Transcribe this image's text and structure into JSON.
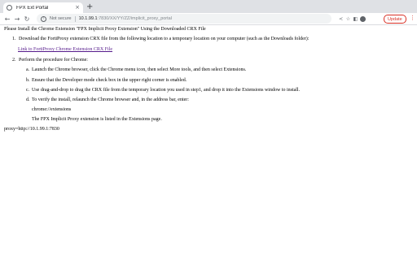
{
  "tab": {
    "title": "FPX Ext Portal",
    "close": "×",
    "new_tab": "+"
  },
  "toolbar": {
    "back": "←",
    "forward": "→",
    "reload": "↻",
    "security_label": "Not secure",
    "url_host": "10.1.99.1",
    "url_rest": ":7830/XX/YY/ZZ/implicit_proxy_portal",
    "share": "≺",
    "bookmark": "☆",
    "sidebar": "◧",
    "update_label": "Update",
    "menu": "⋮"
  },
  "page": {
    "heading": "Please Install the Chrome Extension \"FPX Implicit Proxy Extension\" Using the Downloaded CRX File",
    "step1_num": "1.",
    "step1": "Download the FortiProxy extension CRX file from the following location to a temporary location on your computer (such as the Downloads folder):",
    "link": "Link to FortiProxy Chrome Extension CRX File",
    "step2_num": "2.",
    "step2": "Perform the procedure for Chrome:",
    "sub": [
      {
        "num": "a.",
        "text": "Launch the Chrome browser, click the Chrome menu icon, then select More tools, and then select Extensions."
      },
      {
        "num": "b.",
        "text": "Ensure that the Developer mode check box in the upper right corner is enabled."
      },
      {
        "num": "c.",
        "text": "Use drag-and-drop to drag the CRX file from the temporary location you used in step1, and drop it into the Extensions window to install."
      },
      {
        "num": "d.",
        "text": "To verify the install, relaunch the Chrome browser and, in the address bar, enter:"
      }
    ],
    "ext_url": "chrome://extensions",
    "verify_note": "The FPX Implicit Proxy extension is listed in the Extensions page.",
    "proxy": "proxy=http://10.1.99.1:7830"
  },
  "colors": {
    "accent_warning": "#d93025",
    "link": "#551a8b",
    "desktop": "#5a2a45"
  }
}
